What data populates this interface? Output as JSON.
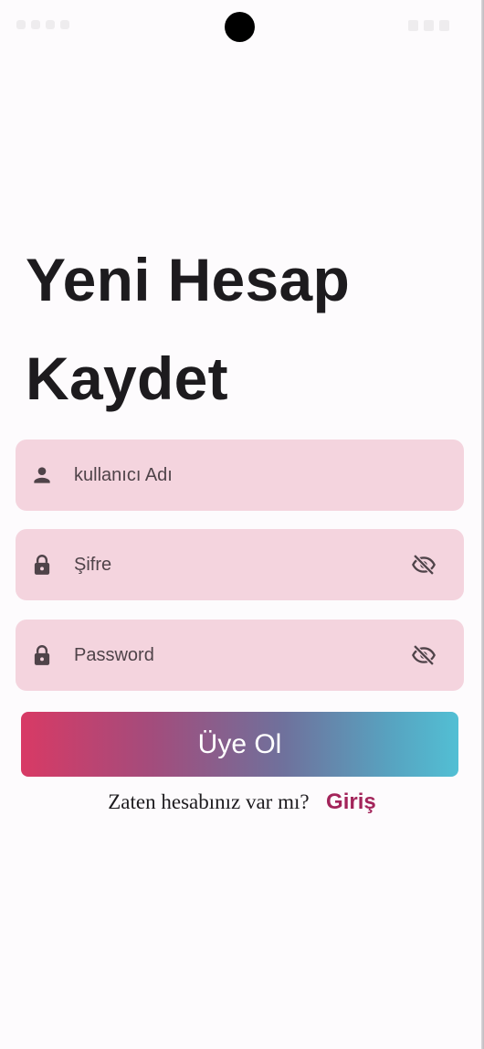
{
  "header": {
    "title_line1": "Yeni Hesap",
    "title_line2": "Kaydet"
  },
  "form": {
    "username": {
      "placeholder": "kullanıcı Adı",
      "value": "",
      "icon": "person-icon"
    },
    "password": {
      "placeholder": "Şifre",
      "value": "",
      "icon": "lock-icon",
      "toggle_icon": "eye-off-icon"
    },
    "password_confirm": {
      "placeholder": "Password",
      "value": "",
      "icon": "lock-icon",
      "toggle_icon": "eye-off-icon"
    },
    "submit_label": "Üye Ol"
  },
  "footer": {
    "question": "Zaten hesabınız var mı?",
    "login_link": "Giriş"
  },
  "colors": {
    "background": "#fdfbfd",
    "field_background": "#f4d4de",
    "title_text": "#1d1b1e",
    "icon": "#4f4349",
    "button_gradient_start": "#d83a65",
    "button_gradient_end": "#52bfd4",
    "link": "#a3245a"
  }
}
